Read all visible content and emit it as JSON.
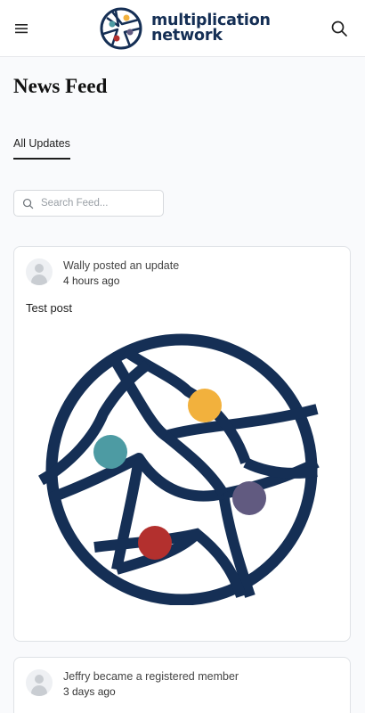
{
  "header": {
    "brand_line1": "multiplication",
    "brand_line2": "network",
    "menu_icon": "hamburger-menu-icon",
    "search_icon": "search-icon",
    "brand_color": "#152f55"
  },
  "page": {
    "title": "News Feed",
    "tabs": [
      {
        "label": "All Updates",
        "active": true
      }
    ],
    "search_placeholder": "Search Feed..."
  },
  "feed": [
    {
      "action": "Wally posted an update",
      "time": "4 hours ago",
      "text": "Test post",
      "image": "multiplication-network-logo"
    },
    {
      "action": "Jeffry became a registered member",
      "time": "3 days ago"
    }
  ],
  "logo_colors": {
    "ring": "#152f55",
    "yellow": "#f2b13d",
    "teal": "#4d9ba3",
    "purple": "#615a80",
    "red": "#b3302e"
  }
}
